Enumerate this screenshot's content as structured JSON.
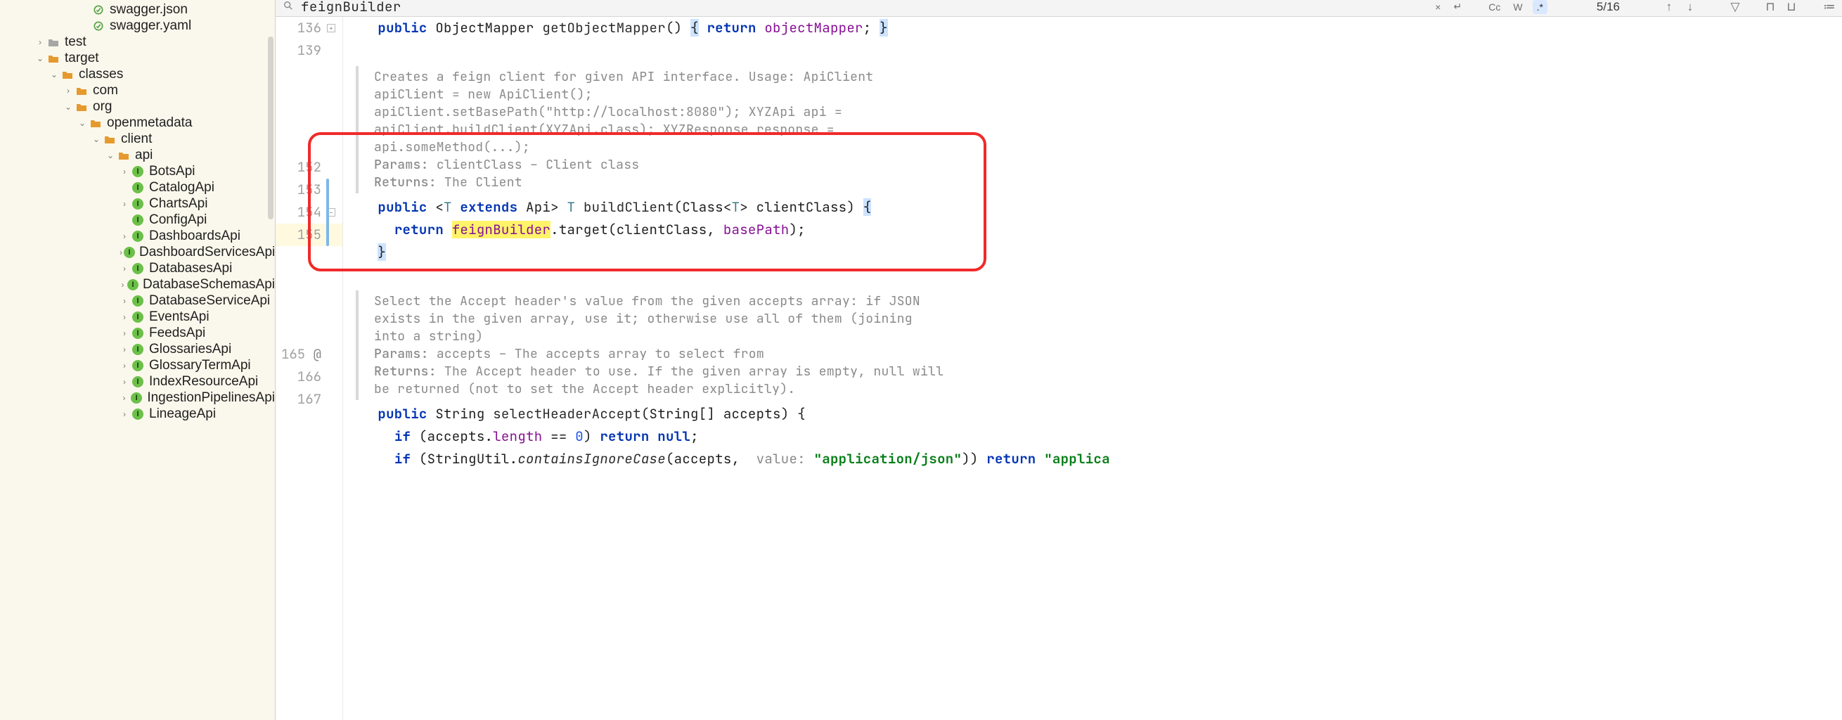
{
  "find": {
    "query": "feignBuilder",
    "matches": "5/16",
    "cc": "Cc",
    "w": "W",
    "regex": ".*",
    "close": "×",
    "enter": "↵"
  },
  "sidebar": {
    "topFiles": [
      {
        "name": "swagger.json",
        "icon": "file-json"
      },
      {
        "name": "swagger.yaml",
        "icon": "file-yaml"
      }
    ],
    "items": [
      {
        "depth": 0,
        "chev": "right",
        "icon": "folder-gray",
        "label": "test"
      },
      {
        "depth": 0,
        "chev": "down",
        "icon": "folder-yellow",
        "label": "target"
      },
      {
        "depth": 1,
        "chev": "down",
        "icon": "folder-yellow",
        "label": "classes"
      },
      {
        "depth": 2,
        "chev": "right",
        "icon": "folder-yellow",
        "label": "com"
      },
      {
        "depth": 2,
        "chev": "down",
        "icon": "folder-yellow",
        "label": "org"
      },
      {
        "depth": 3,
        "chev": "down",
        "icon": "folder-yellow",
        "label": "openmetadata"
      },
      {
        "depth": 4,
        "chev": "down",
        "icon": "folder-yellow",
        "label": "client"
      },
      {
        "depth": 5,
        "chev": "down",
        "icon": "folder-yellow",
        "label": "api"
      },
      {
        "depth": 6,
        "chev": "right",
        "icon": "i-circle",
        "label": "BotsApi"
      },
      {
        "depth": 6,
        "chev": "",
        "icon": "i-circle",
        "label": "CatalogApi"
      },
      {
        "depth": 6,
        "chev": "right",
        "icon": "i-circle",
        "label": "ChartsApi"
      },
      {
        "depth": 6,
        "chev": "",
        "icon": "i-circle",
        "label": "ConfigApi"
      },
      {
        "depth": 6,
        "chev": "right",
        "icon": "i-circle",
        "label": "DashboardsApi"
      },
      {
        "depth": 6,
        "chev": "right",
        "icon": "i-circle",
        "label": "DashboardServicesApi"
      },
      {
        "depth": 6,
        "chev": "right",
        "icon": "i-circle",
        "label": "DatabasesApi"
      },
      {
        "depth": 6,
        "chev": "right",
        "icon": "i-circle",
        "label": "DatabaseSchemasApi"
      },
      {
        "depth": 6,
        "chev": "right",
        "icon": "i-circle",
        "label": "DatabaseServiceApi"
      },
      {
        "depth": 6,
        "chev": "right",
        "icon": "i-circle",
        "label": "EventsApi"
      },
      {
        "depth": 6,
        "chev": "right",
        "icon": "i-circle",
        "label": "FeedsApi"
      },
      {
        "depth": 6,
        "chev": "right",
        "icon": "i-circle",
        "label": "GlossariesApi"
      },
      {
        "depth": 6,
        "chev": "right",
        "icon": "i-circle",
        "label": "GlossaryTermApi"
      },
      {
        "depth": 6,
        "chev": "right",
        "icon": "i-circle",
        "label": "IndexResourceApi"
      },
      {
        "depth": 6,
        "chev": "right",
        "icon": "i-circle",
        "label": "IngestionPipelinesApi"
      },
      {
        "depth": 6,
        "chev": "right",
        "icon": "i-circle",
        "label": "LineageApi"
      }
    ]
  },
  "gutter": {
    "lines": [
      "136",
      "139",
      "",
      "152",
      "153",
      "154",
      "155",
      "",
      "165",
      "166",
      "167"
    ],
    "at": "@"
  },
  "code": {
    "l136": {
      "public": "public",
      "type": "ObjectMapper",
      "name": "getObjectMapper",
      "parens": "()",
      "ob": "{",
      "return": "return",
      "field": "objectMapper",
      "semi": ";",
      "cb": "}"
    },
    "doc1": {
      "body": "Creates a feign client for given API interface. Usage: ApiClient apiClient = new ApiClient(); apiClient.setBasePath(\"http://localhost:8080\"); XYZApi api = apiClient.buildClient(XYZApi.class); XYZResponse response = api.someMethod(...);",
      "paramsLabel": "Params:",
      "paramsText": "clientClass – Client class",
      "returnsLabel": "Returns:",
      "returnsText": "The Client"
    },
    "l152": {
      "public": "public",
      "lt": "<",
      "T": "T",
      "extends": "extends",
      "Api": "Api",
      "gt": ">",
      "T2": "T",
      "name": "buildClient",
      "sig": "(Class<",
      "Tg": "T",
      "sig2": "> clientClass)",
      "ob": "{"
    },
    "l153": {
      "return": "return",
      "feign": "feignBuilder",
      "mid": ".target(clientClass, ",
      "base": "basePath",
      "end": ");"
    },
    "l154": {
      "cb": "}"
    },
    "doc2": {
      "body": "Select the Accept header's value from the given accepts array: if JSON exists in the given array, use it; otherwise use all of them (joining into a string)",
      "paramsLabel": "Params:",
      "paramsText": "accepts – The accepts array to select from",
      "returnsLabel": "Returns:",
      "returnsText": "The Accept header to use. If the given array is empty, null will be returned (not to set the Accept header explicitly)."
    },
    "l165": {
      "public": "public",
      "type": "String",
      "name": "selectHeaderAccept",
      "sig": "(String[] accepts)",
      "ob": "{"
    },
    "l166": {
      "if": "if",
      "cond": "(accepts.",
      "len": "length",
      "eq": " == ",
      "zero": "0",
      "cp": ") ",
      "return": "return",
      "null": "null",
      "semi": ";"
    },
    "l167": {
      "if": "if",
      "op": "(StringUtil.",
      "m": "containsIgnoreCase",
      "args1": "(accepts, ",
      "hint": " value:",
      "str": "\"application/json\"",
      "args2": ")) ",
      "return": "return",
      "str2": "\"applica"
    }
  }
}
